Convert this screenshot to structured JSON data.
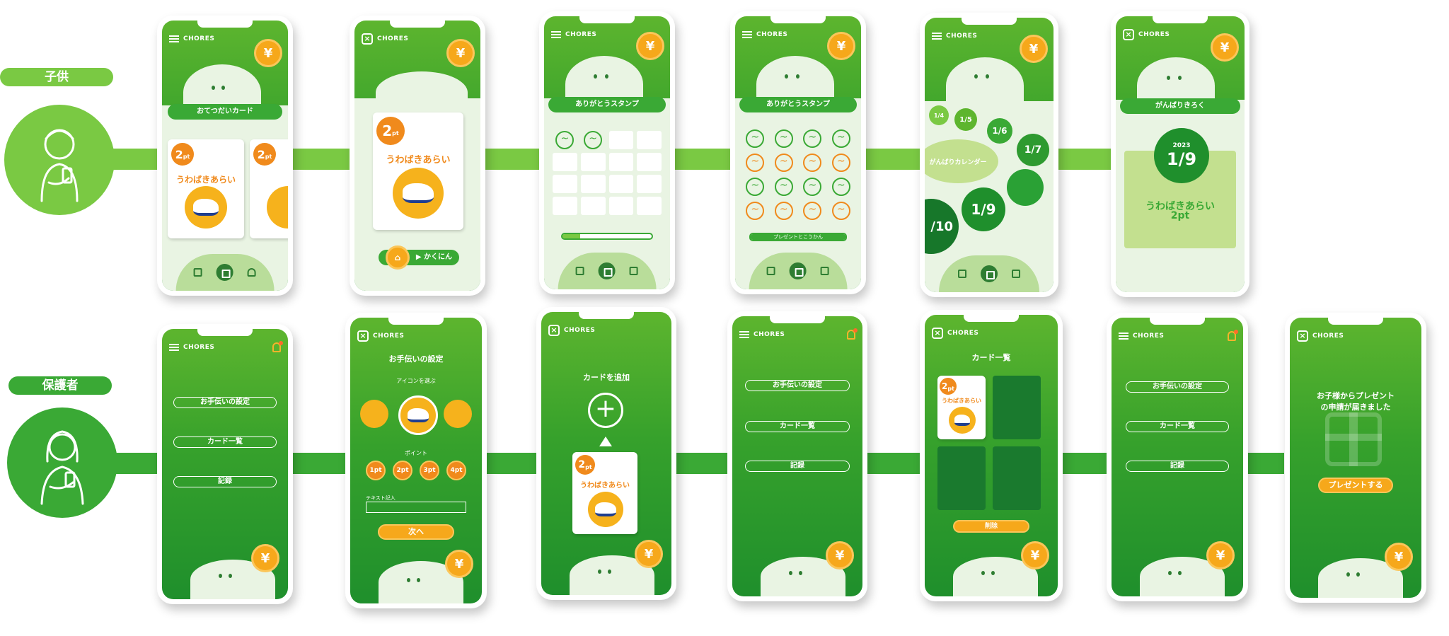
{
  "rows": {
    "child_label": "子供",
    "parent_label": "保護者"
  },
  "common": {
    "logo": "CHORES",
    "yen": "¥"
  },
  "child_screens": {
    "s1": {
      "banner": "おてつだいカード",
      "card_pt": "2",
      "card_pt_unit": "pt",
      "card_title": "うわばきあらい"
    },
    "s2": {
      "card_pt": "2",
      "card_pt_unit": "pt",
      "card_title": "うわばきあらい",
      "confirm": "▶ かくにん"
    },
    "s3": {
      "banner": "ありがとうスタンプ",
      "progress": 0.2
    },
    "s4": {
      "banner": "ありがとうスタンプ",
      "progress_label": "プレゼントとこうかん",
      "progress": 1.0
    },
    "s5": {
      "calendar_label": "がんばりカレンダー",
      "dates": [
        "1/4",
        "1/5",
        "1/6",
        "1/7",
        "1/9",
        "/10"
      ]
    },
    "s6": {
      "banner": "がんばりきろく",
      "year": "2023",
      "date": "1/9",
      "task": "うわばきあらい",
      "points": "2pt"
    }
  },
  "parent_screens": {
    "p1": {
      "menu": [
        "お手伝いの設定",
        "カード一覧",
        "記録"
      ]
    },
    "p2": {
      "title": "お手伝いの設定",
      "icon_label": "アイコンを選ぶ",
      "point_label": "ポイント",
      "points": [
        "1pt",
        "2pt",
        "3pt",
        "4pt"
      ],
      "text_label": "テキスト記入",
      "next": "次へ"
    },
    "p3": {
      "title": "カードを追加",
      "plus": "+",
      "card_pt": "2",
      "card_pt_unit": "pt",
      "card_title": "うわばきあらい"
    },
    "p4": {
      "menu": [
        "お手伝いの設定",
        "カード一覧",
        "記録"
      ]
    },
    "p5": {
      "title": "カード一覧",
      "card_pt": "2",
      "card_pt_unit": "pt",
      "card_title": "うわばきあらい",
      "delete": "削除"
    },
    "p6": {
      "menu": [
        "お手伝いの設定",
        "カード一覧",
        "記録"
      ]
    },
    "p7": {
      "message_line1": "お子様からプレゼント",
      "message_line2": "の申請が届きました",
      "action": "プレゼントする"
    }
  }
}
